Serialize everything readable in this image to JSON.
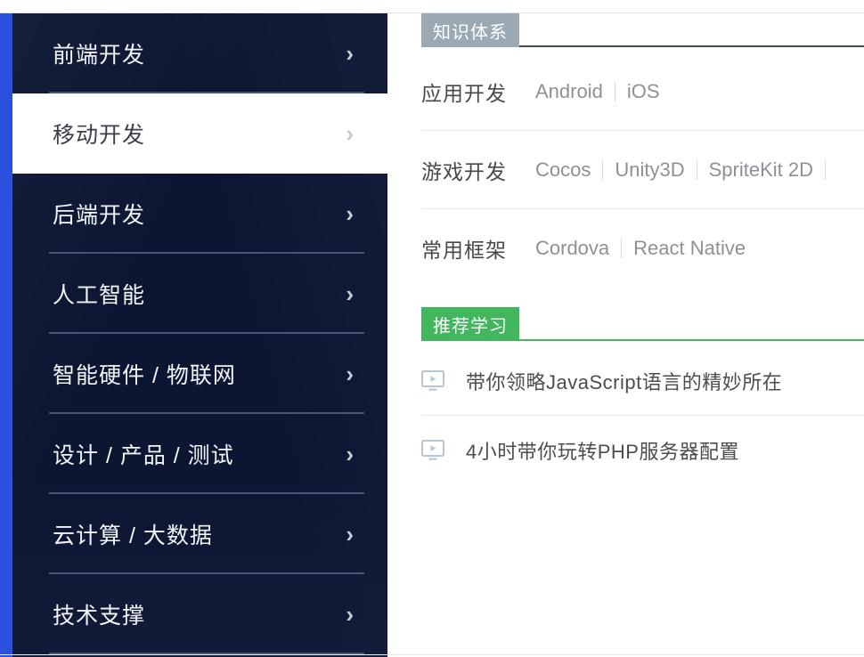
{
  "sidebar": {
    "accent_color": "#2a51de",
    "background_color": "#0c1633",
    "items": [
      {
        "label": "前端开发",
        "chevron": "chevron-right-icon",
        "chevron_glyph": "›",
        "active": false
      },
      {
        "label": "移动开发",
        "chevron": "chevron-right-icon",
        "chevron_glyph": "›",
        "active": true
      },
      {
        "label": "后端开发",
        "chevron": "chevron-right-icon",
        "chevron_glyph": "›",
        "active": false
      },
      {
        "label": "人工智能",
        "chevron": "chevron-right-icon",
        "chevron_glyph": "›",
        "active": false
      },
      {
        "label": "智能硬件 / 物联网",
        "chevron": "chevron-right-icon",
        "chevron_glyph": "›",
        "active": false
      },
      {
        "label": "设计 / 产品 / 测试",
        "chevron": "chevron-right-icon",
        "chevron_glyph": "›",
        "active": false
      },
      {
        "label": "云计算 / 大数据",
        "chevron": "chevron-right-icon",
        "chevron_glyph": "›",
        "active": false
      },
      {
        "label": "技术支撑",
        "chevron": "chevron-right-icon",
        "chevron_glyph": "›",
        "active": false
      }
    ]
  },
  "panel": {
    "knowledge": {
      "badge": "知识体系",
      "badge_color": "#9aa9b4",
      "rows": [
        {
          "label": "应用开发",
          "items": [
            "Android",
            "iOS"
          ]
        },
        {
          "label": "游戏开发",
          "items": [
            "Cocos",
            "Unity3D",
            "SpriteKit 2D",
            ""
          ]
        },
        {
          "label": "常用框架",
          "items": [
            "Cordova",
            "React Native"
          ]
        }
      ]
    },
    "recommended": {
      "badge": "推荐学习",
      "badge_color": "#42b65c",
      "items": [
        {
          "icon": "video-monitor-icon",
          "title": "带你领略JavaScript语言的精妙所在"
        },
        {
          "icon": "video-monitor-icon",
          "title": "4小时带你玩转PHP服务器配置"
        }
      ]
    }
  }
}
